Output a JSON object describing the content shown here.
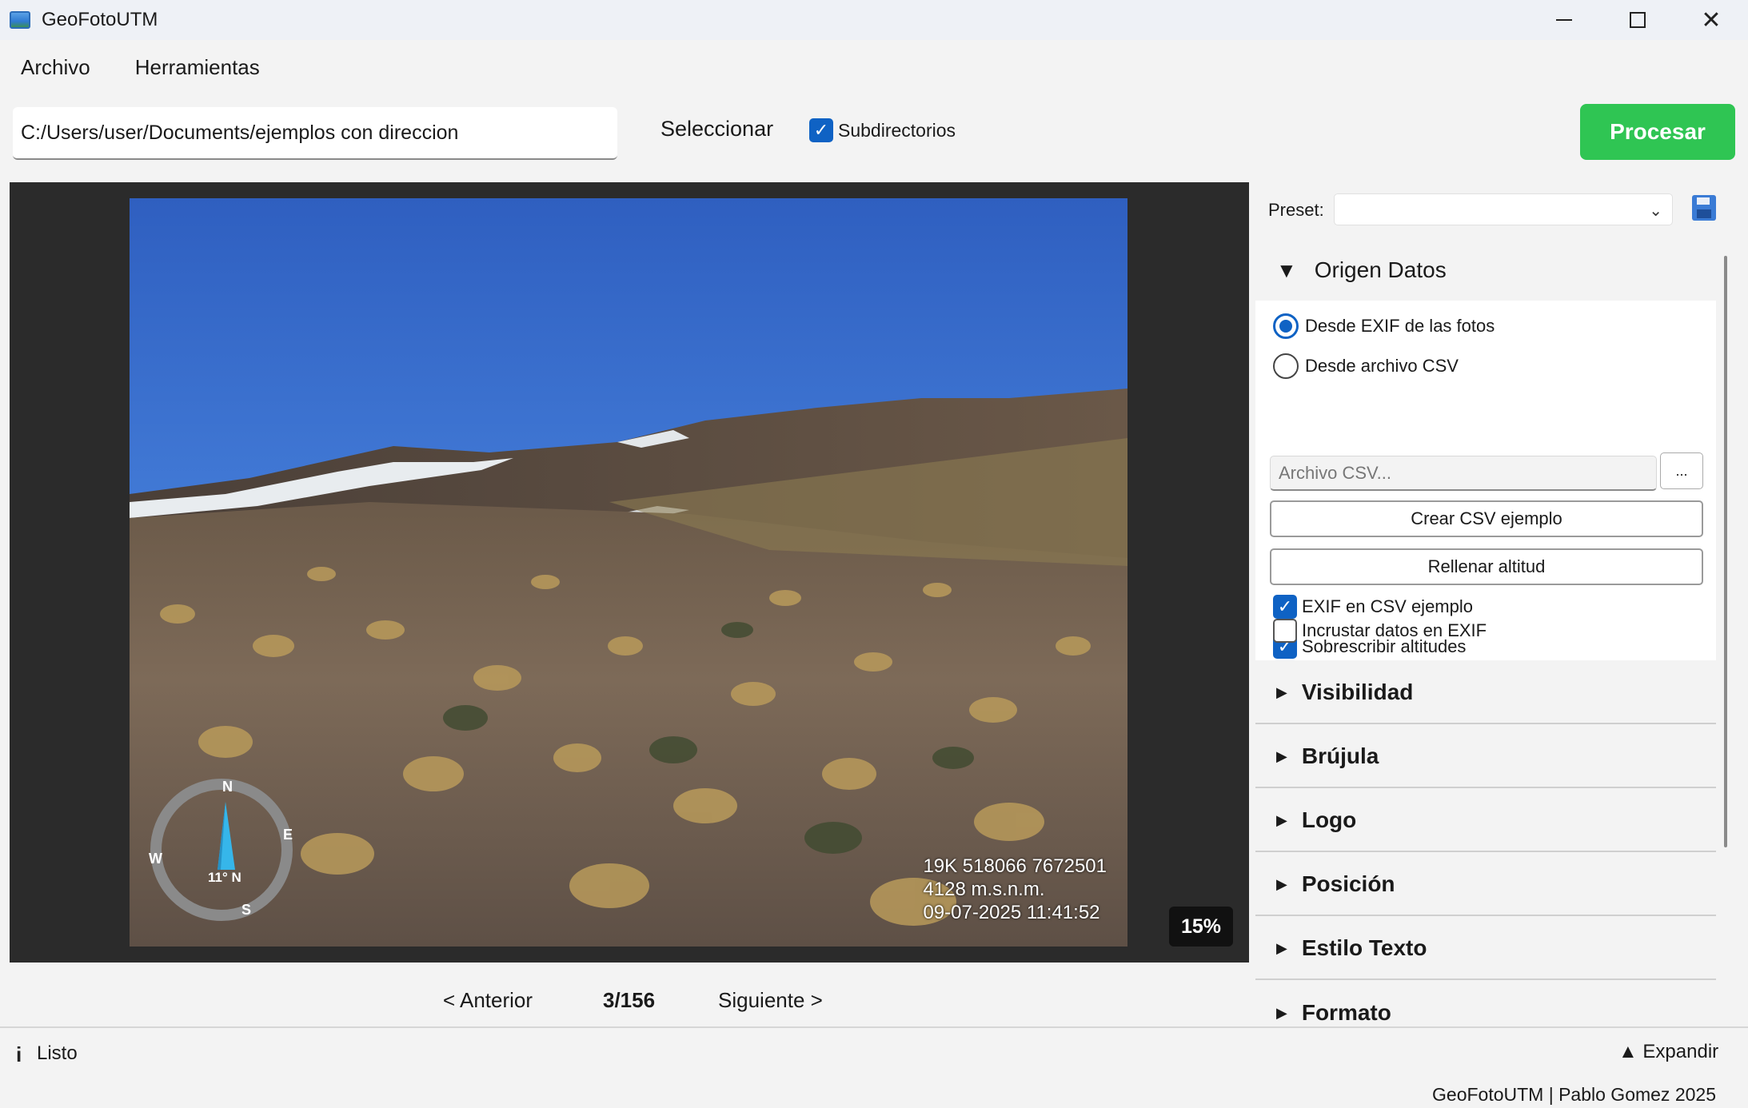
{
  "window": {
    "title": "GeoFotoUTM",
    "minimize_glyph": "—",
    "close_glyph": "✕"
  },
  "menu": {
    "items": [
      "Archivo",
      "Herramientas"
    ]
  },
  "toolbar": {
    "path_value": "C:/Users/user/Documents/ejemplos con direccion",
    "select_label": "Seleccionar",
    "subdir_label": "Subdirectorios",
    "subdir_checked": true,
    "process_label": "Procesar",
    "process_color": "#2fc553"
  },
  "preview": {
    "overlay_lines": [
      "19K 518066 7672501",
      "4128 m.s.n.m.",
      "09-07-2025 11:41:52"
    ],
    "zoom": "15%",
    "compass": {
      "north": "N",
      "east": "E",
      "south": "S",
      "west": "W",
      "bearing": "11° N"
    }
  },
  "navigation": {
    "prev_label": "< Anterior",
    "counter": "3/156",
    "next_label": "Siguiente >"
  },
  "panel": {
    "preset_label": "Preset:",
    "preset_value": "",
    "sections": {
      "origen": {
        "title": "Origen Datos",
        "radio_exif": "Desde EXIF de las fotos",
        "radio_csv": "Desde archivo CSV",
        "csv_placeholder": "Archivo CSV...",
        "browse_label": "...",
        "create_csv_label": "Crear CSV ejemplo",
        "fill_alt_label": "Rellenar altitud",
        "chk_exif_csv": "EXIF en CSV ejemplo",
        "chk_overwrite": "Sobrescribir altitudes",
        "chk_embed": "Incrustar datos en EXIF"
      },
      "collapsed": [
        "Visibilidad",
        "Brújula",
        "Logo",
        "Posición",
        "Estilo Texto",
        "Formato"
      ]
    }
  },
  "status": {
    "icon": "i",
    "text": "Listo",
    "expand_label": "▲ Expandir",
    "footer": "GeoFotoUTM | Pablo Gomez 2025"
  }
}
